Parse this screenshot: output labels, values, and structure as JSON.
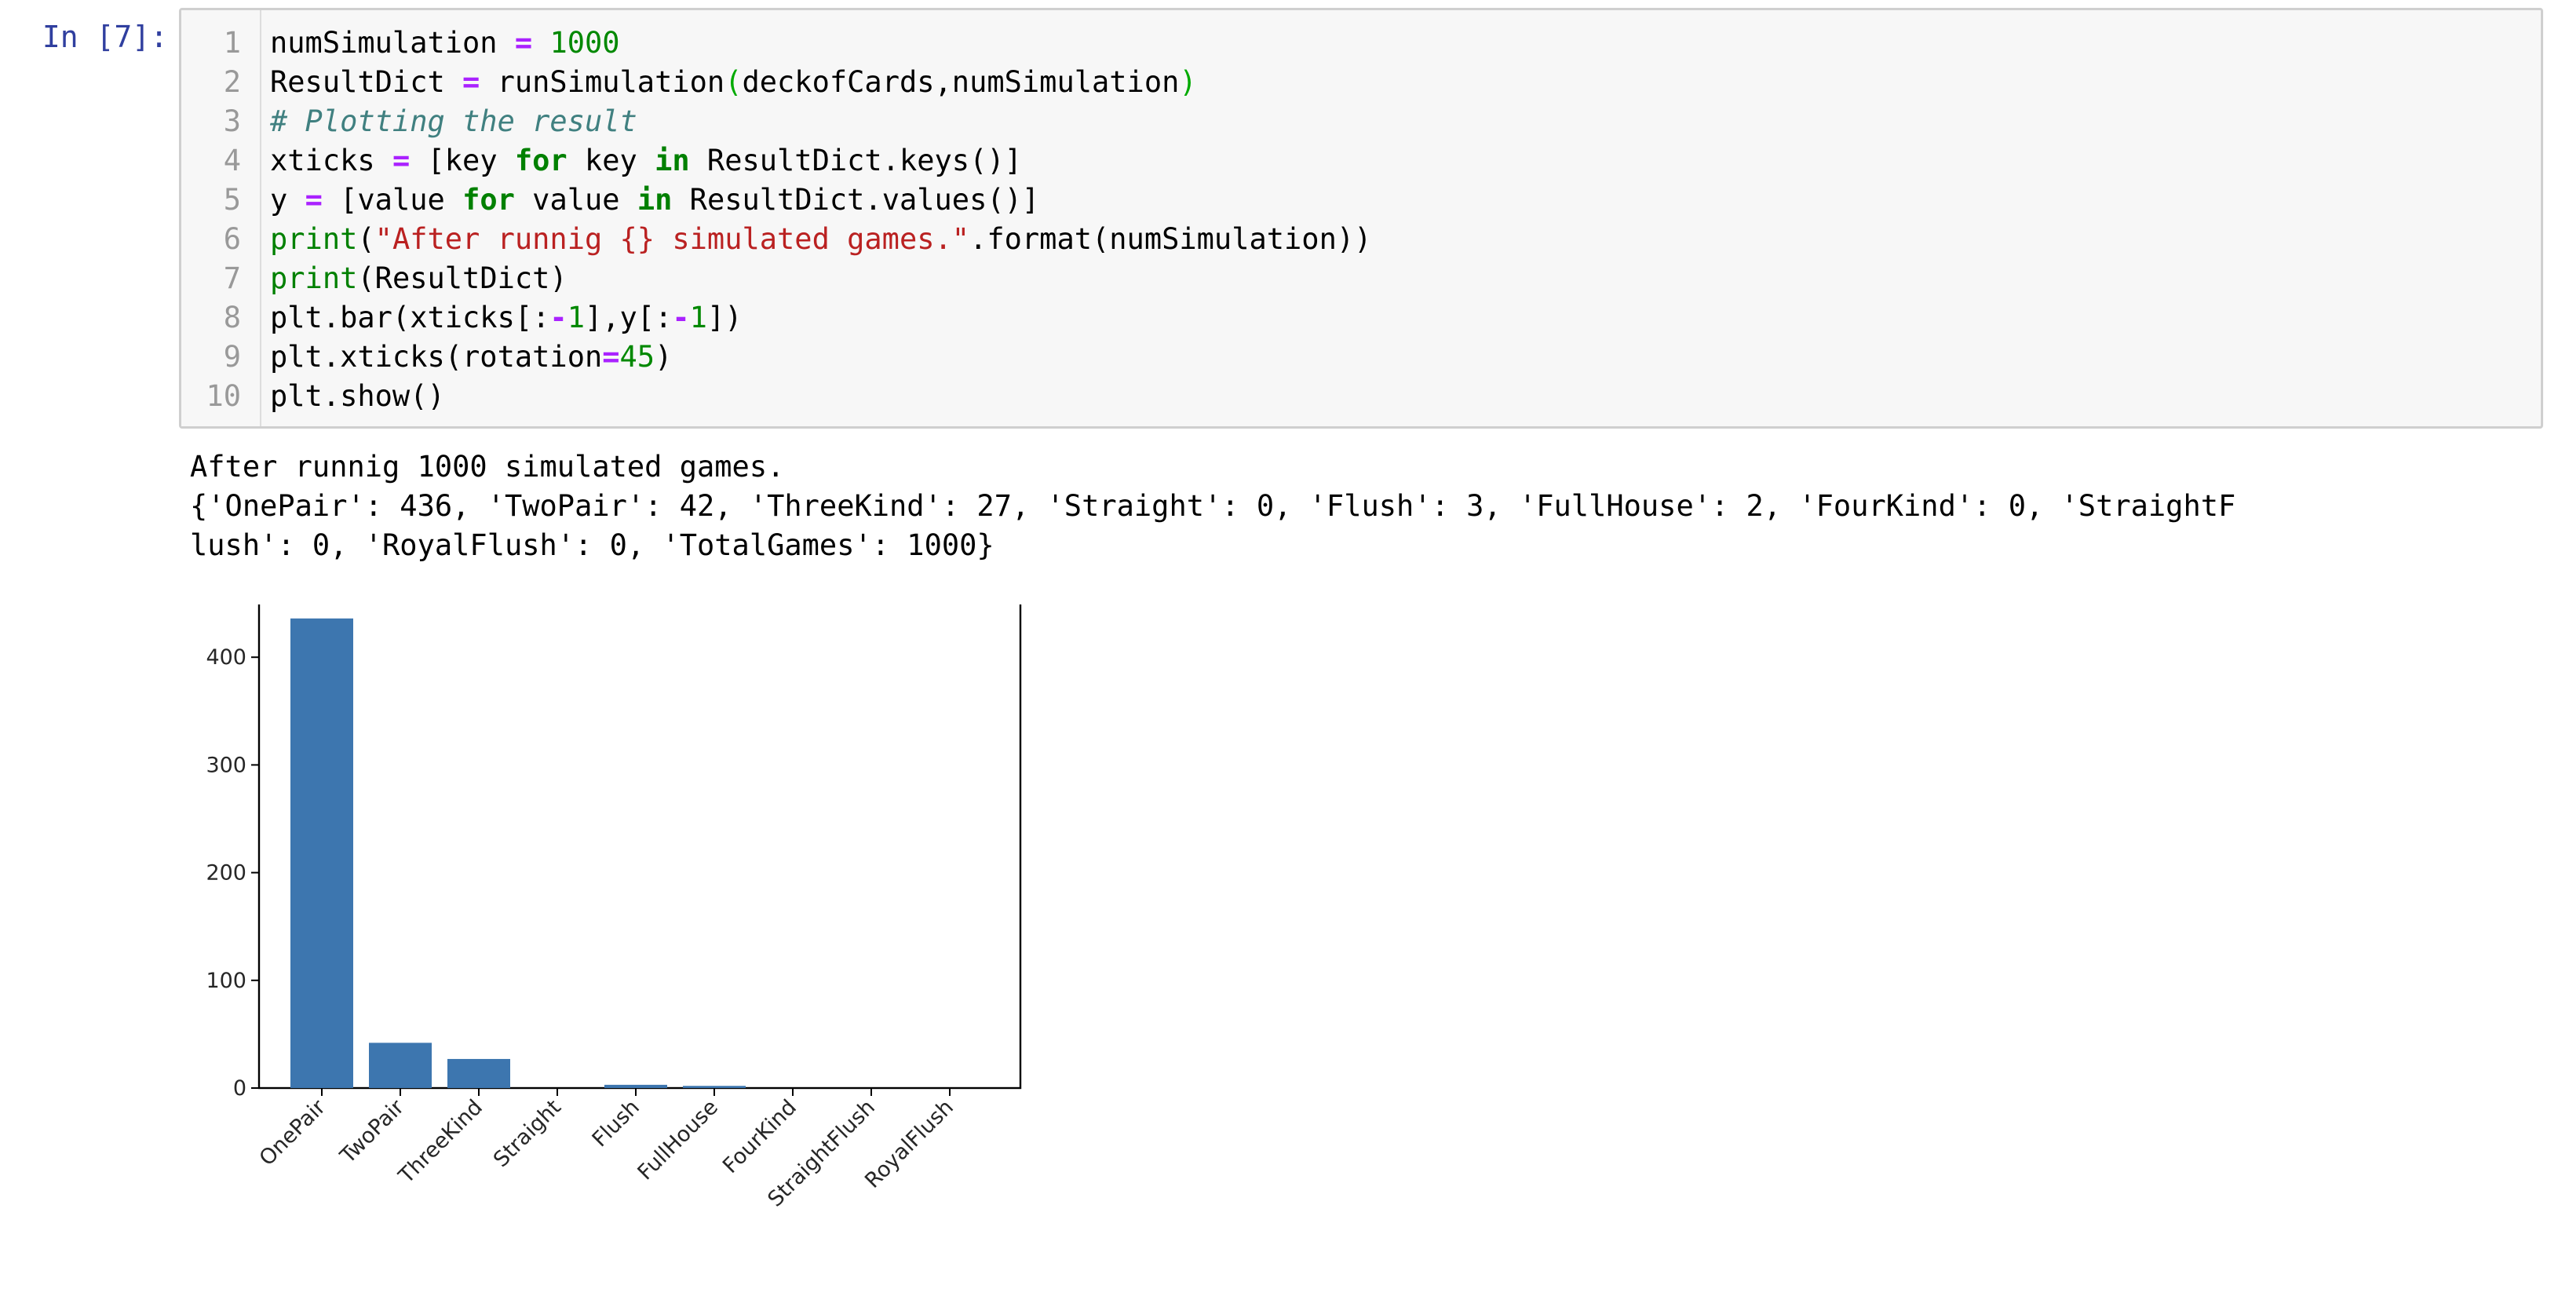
{
  "cell": {
    "prompt": "In [7]:",
    "line_numbers": [
      "1",
      "2",
      "3",
      "4",
      "5",
      "6",
      "7",
      "8",
      "9",
      "10"
    ],
    "code_lines": [
      [
        {
          "t": "numSimulation ",
          "c": ""
        },
        {
          "t": "=",
          "c": "op"
        },
        {
          "t": " ",
          "c": ""
        },
        {
          "t": "1000",
          "c": "num"
        }
      ],
      [
        {
          "t": "ResultDict ",
          "c": ""
        },
        {
          "t": "=",
          "c": "op"
        },
        {
          "t": " runSimulation",
          "c": ""
        },
        {
          "t": "(",
          "c": "par"
        },
        {
          "t": "deckofCards,numSimulation",
          "c": ""
        },
        {
          "t": ")",
          "c": "par"
        }
      ],
      [
        {
          "t": "# Plotting the result",
          "c": "cm"
        }
      ],
      [
        {
          "t": "xticks ",
          "c": ""
        },
        {
          "t": "=",
          "c": "op"
        },
        {
          "t": " [key ",
          "c": ""
        },
        {
          "t": "for",
          "c": "kw"
        },
        {
          "t": " key ",
          "c": ""
        },
        {
          "t": "in",
          "c": "kw"
        },
        {
          "t": " ResultDict.keys()]",
          "c": ""
        }
      ],
      [
        {
          "t": "y ",
          "c": ""
        },
        {
          "t": "=",
          "c": "op"
        },
        {
          "t": " [value ",
          "c": ""
        },
        {
          "t": "for",
          "c": "kw"
        },
        {
          "t": " value ",
          "c": ""
        },
        {
          "t": "in",
          "c": "kw"
        },
        {
          "t": " ResultDict.values()]",
          "c": ""
        }
      ],
      [
        {
          "t": "print",
          "c": "bi"
        },
        {
          "t": "(",
          "c": ""
        },
        {
          "t": "\"After runnig {} simulated games.\"",
          "c": "str"
        },
        {
          "t": ".format(numSimulation))",
          "c": ""
        }
      ],
      [
        {
          "t": "print",
          "c": "bi"
        },
        {
          "t": "(ResultDict)",
          "c": ""
        }
      ],
      [
        {
          "t": "plt.bar(xticks[:",
          "c": ""
        },
        {
          "t": "-",
          "c": "op"
        },
        {
          "t": "1",
          "c": "num"
        },
        {
          "t": "],y[:",
          "c": ""
        },
        {
          "t": "-",
          "c": "op"
        },
        {
          "t": "1",
          "c": "num"
        },
        {
          "t": "])",
          "c": ""
        }
      ],
      [
        {
          "t": "plt.xticks(rotation",
          "c": ""
        },
        {
          "t": "=",
          "c": "op"
        },
        {
          "t": "45",
          "c": "num"
        },
        {
          "t": ")",
          "c": ""
        }
      ],
      [
        {
          "t": "plt.show()",
          "c": ""
        }
      ]
    ]
  },
  "output": {
    "lines": [
      "After runnig 1000 simulated games.",
      "{'OnePair': 436, 'TwoPair': 42, 'ThreeKind': 27, 'Straight': 0, 'Flush': 3, 'FullHouse': 2, 'FourKind': 0, 'StraightF",
      "lush': 0, 'RoyalFlush': 0, 'TotalGames': 1000}"
    ]
  },
  "chart_data": {
    "type": "bar",
    "categories": [
      "OnePair",
      "TwoPair",
      "ThreeKind",
      "Straight",
      "Flush",
      "FullHouse",
      "FourKind",
      "StraightFlush",
      "RoyalFlush"
    ],
    "values": [
      436,
      42,
      27,
      0,
      3,
      2,
      0,
      0,
      0
    ],
    "ylim": [
      0,
      460
    ],
    "yticks": [
      0,
      100,
      200,
      300,
      400
    ],
    "xtick_rotation": 45,
    "bar_color": "#3d76af",
    "grid": false,
    "title": "",
    "xlabel": "",
    "ylabel": ""
  }
}
